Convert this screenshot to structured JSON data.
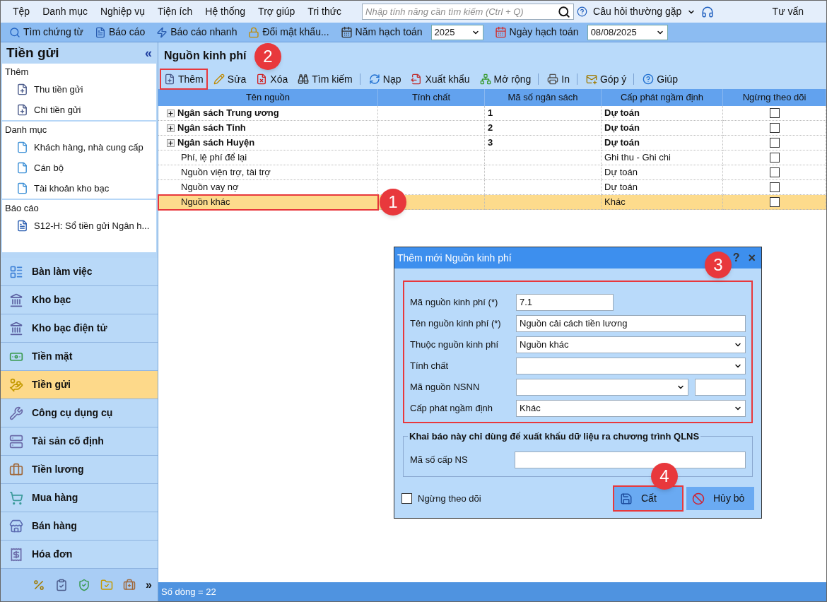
{
  "menu": [
    "Tệp",
    "Danh mục",
    "Nghiệp vụ",
    "Tiện ích",
    "Hệ thống",
    "Trợ giúp",
    "Tri thức"
  ],
  "search": {
    "placeholder": "Nhập tính năng cần tìm kiếm (Ctrl + Q)"
  },
  "help_menu": "Câu hỏi thường gặp",
  "consult": "Tư vấn",
  "quickbar": [
    "Tìm chứng từ",
    "Báo cáo",
    "Báo cáo nhanh",
    "Đổi mật khẩu..."
  ],
  "year": {
    "label": "Năm hạch toán",
    "value": "2025"
  },
  "date": {
    "label": "Ngày hạch toán",
    "value": "08/08/2025"
  },
  "sidebar": {
    "title": "Tiền gửi",
    "collapse": "«",
    "sections": [
      {
        "title": "Thêm",
        "items": [
          "Thu tiền gửi",
          "Chi tiền gửi"
        ]
      },
      {
        "title": "Danh mục",
        "items": [
          "Khách hàng, nhà cung cấp",
          "Cán bộ",
          "Tài khoản kho bạc"
        ]
      },
      {
        "title": "Báo cáo",
        "items": [
          "S12-H: Sổ tiền gửi Ngân h..."
        ]
      }
    ],
    "nav": [
      {
        "label": "Bàn làm việc",
        "selected": false
      },
      {
        "label": "Kho bạc",
        "selected": false
      },
      {
        "label": "Kho bạc điện tử",
        "selected": false
      },
      {
        "label": "Tiền mặt",
        "selected": false
      },
      {
        "label": "Tiền gửi",
        "selected": true
      },
      {
        "label": "Công cụ dụng cụ",
        "selected": false
      },
      {
        "label": "Tài sản cố định",
        "selected": false
      },
      {
        "label": "Tiền lương",
        "selected": false
      },
      {
        "label": "Mua hàng",
        "selected": false
      },
      {
        "label": "Bán hàng",
        "selected": false
      },
      {
        "label": "Hóa đơn",
        "selected": false
      }
    ],
    "more": "»"
  },
  "page": {
    "title": "Nguồn kinh phí",
    "toolbar": [
      {
        "label": "Thêm",
        "highlighted": true,
        "badge": "2"
      },
      {
        "label": "Sửa",
        "highlighted": false
      },
      {
        "label": "Xóa",
        "highlighted": false
      },
      {
        "label": "Tìm kiếm",
        "highlighted": false
      },
      {
        "label": "Nạp",
        "highlighted": false
      },
      {
        "label": "Xuất khẩu",
        "highlighted": false
      },
      {
        "label": "Mở rộng",
        "highlighted": false
      },
      {
        "label": "In",
        "highlighted": false
      },
      {
        "label": "Góp ý",
        "highlighted": false
      },
      {
        "label": "Giúp",
        "highlighted": false
      }
    ],
    "columns": [
      "Tên nguồn",
      "Tính chất",
      "Mã số ngân sách",
      "Cấp phát ngầm định",
      "Ngừng theo dõi"
    ],
    "rows": [
      {
        "name": "Ngân sách Trung ương",
        "kind": "group",
        "code": "1",
        "allocation": "Dự toán",
        "stopped": false,
        "selected": false
      },
      {
        "name": "Ngân sách Tỉnh",
        "kind": "group",
        "code": "2",
        "allocation": "Dự toán",
        "stopped": false,
        "selected": false
      },
      {
        "name": "Ngân sách Huyện",
        "kind": "group",
        "code": "3",
        "allocation": "Dự toán",
        "stopped": false,
        "selected": false
      },
      {
        "name": "Phí, lệ phí để lại",
        "kind": "item",
        "allocation": "Ghi thu - Ghi chi",
        "stopped": false,
        "selected": false
      },
      {
        "name": "Nguồn viện trợ, tài trợ",
        "kind": "item",
        "allocation": "Dự toán",
        "stopped": false,
        "selected": false
      },
      {
        "name": "Nguồn vay nợ",
        "kind": "item",
        "allocation": "Dự toán",
        "stopped": false,
        "selected": false
      },
      {
        "name": "Nguồn khác",
        "kind": "item",
        "allocation": "Khác",
        "stopped": false,
        "selected": true,
        "badge": "1"
      }
    ],
    "status": "Số dòng = 22"
  },
  "dialog": {
    "title": "Thêm mới Nguồn kinh phí",
    "help": "?",
    "close": "×",
    "badge": "3",
    "fields": [
      {
        "label": "Mã nguồn kinh phí (*)",
        "kind": "short",
        "value": "7.1"
      },
      {
        "label": "Tên nguồn kinh phí (*)",
        "kind": "text",
        "value": "Nguồn cải cách tiền lương"
      },
      {
        "label": "Thuộc nguồn kinh phí",
        "kind": "select",
        "value": "Nguồn khác"
      },
      {
        "label": "Tính chất",
        "kind": "select"
      },
      {
        "label": "Mã nguồn NSNN",
        "kind": "select_extra"
      },
      {
        "label": "Cấp phát ngầm định",
        "kind": "select",
        "value": "Khác"
      }
    ],
    "group": {
      "title": "Khai báo này chỉ dùng để xuất khẩu dữ liệu ra chương trình QLNS",
      "fields": [
        "Mã số cấp NS"
      ]
    },
    "stop": {
      "label": "Ngừng theo dõi",
      "checked": false
    },
    "buttons": [
      {
        "label": "Cất",
        "highlighted": true,
        "badge": "4"
      },
      {
        "label": "Hủy bỏ",
        "highlighted": false
      }
    ]
  }
}
